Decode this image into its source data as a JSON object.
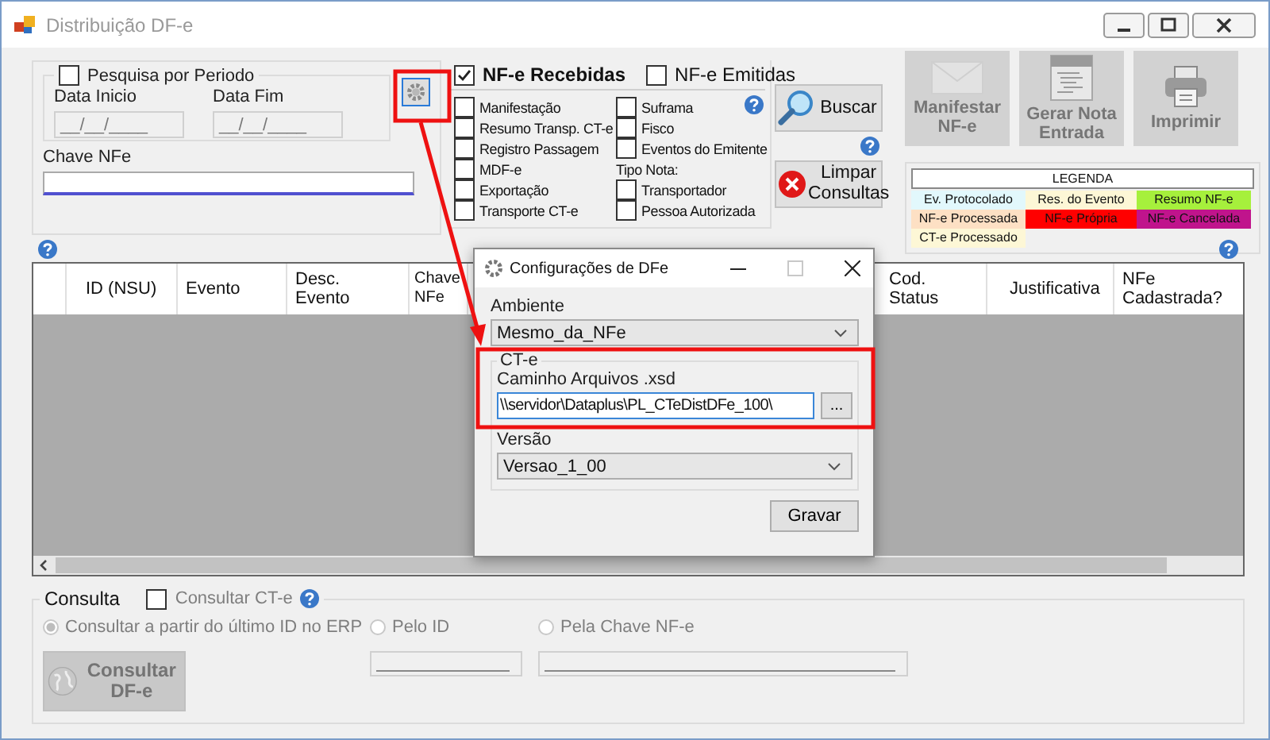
{
  "window": {
    "title": "Distribuição DF-e"
  },
  "period": {
    "label": "Pesquisa por Periodo",
    "checked": false,
    "date_start": {
      "label": "Data Inicio",
      "placeholder": "__/__/____"
    },
    "date_end": {
      "label": "Data Fim",
      "placeholder": "__/__/____"
    }
  },
  "chave_nfe": {
    "label": "Chave NFe"
  },
  "filters": {
    "main": [
      {
        "label": "NF-e Recebidas",
        "checked": true
      },
      {
        "label": "NF-e Emitidas",
        "checked": false
      }
    ],
    "column_1": [
      {
        "label": "Manifestação",
        "checked": false
      },
      {
        "label": "Resumo Transp. CT-e",
        "checked": false
      },
      {
        "label": "Registro Passagem",
        "checked": false
      },
      {
        "label": "MDF-e",
        "checked": false
      },
      {
        "label": "Exportação",
        "checked": false
      },
      {
        "label": "Transporte CT-e",
        "checked": false
      }
    ],
    "column_2": [
      {
        "kind": "checkbox",
        "label": "Suframa",
        "checked": false
      },
      {
        "kind": "checkbox",
        "label": "Fisco",
        "checked": false
      },
      {
        "kind": "checkbox",
        "label": "Eventos do Emitente",
        "checked": false
      },
      {
        "kind": "heading",
        "label": "Tipo Nota:"
      },
      {
        "kind": "checkbox",
        "label": "Transportador",
        "checked": false
      },
      {
        "kind": "checkbox",
        "label": "Pessoa Autorizada",
        "checked": false
      }
    ]
  },
  "buttons": [
    {
      "kind": "search",
      "label": "Buscar"
    },
    {
      "kind": "clear",
      "label": "Limpar Consultas"
    }
  ],
  "actions": [
    {
      "kind": "envelope",
      "label": "Manifestar NF-e",
      "disabled": true
    },
    {
      "kind": "document",
      "label": "Gerar Nota Entrada",
      "disabled": true
    },
    {
      "kind": "printer",
      "label": "Imprimir",
      "disabled": true
    }
  ],
  "legend": {
    "title": "LEGENDA",
    "items": [
      {
        "label": "Ev. Protocolado",
        "color": "#e2f8fc"
      },
      {
        "label": "Res. do Evento",
        "color": "#fdf7d6"
      },
      {
        "label": "Resumo NF-e",
        "color": "#a6f03c"
      },
      {
        "label": "NF-e Processada",
        "color": "#fde0c4"
      },
      {
        "label": "NF-e Própria",
        "color": "#ff0000"
      },
      {
        "label": "NF-e Cancelada",
        "color": "#c0148c"
      },
      {
        "label": "CT-e Processado",
        "color": "#fdf7d6"
      }
    ]
  },
  "table": {
    "columns_left": [
      "ID (NSU)",
      "Evento",
      "Desc. Evento",
      "Chave NFe"
    ],
    "columns_right": [
      "Cod. Status",
      "Justificativa",
      "NFe Cadastrada?"
    ]
  },
  "consulta": {
    "title": "Consulta",
    "disabled": true,
    "ct_e": {
      "label": "Consultar CT-e",
      "checked": false
    },
    "options": [
      {
        "label": "Consultar a partir do último ID no ERP",
        "selected": true
      },
      {
        "label": "Pelo ID",
        "selected": false
      },
      {
        "label": "Pela Chave NF-e",
        "selected": false
      }
    ],
    "button": {
      "label": "Consultar DF-e"
    }
  },
  "dialog": {
    "title": "Configurações de DFe",
    "ambiente": {
      "label": "Ambiente",
      "value": "Mesmo_da_NFe"
    },
    "group": "CT-e",
    "path": {
      "label": "Caminho Arquivos .xsd",
      "value": "\\\\servidor\\Dataplus\\PL_CTeDistDFe_100\\"
    },
    "browse": "...",
    "versao": {
      "label": "Versão",
      "value": "Versao_1_00"
    },
    "save": "Gravar"
  }
}
